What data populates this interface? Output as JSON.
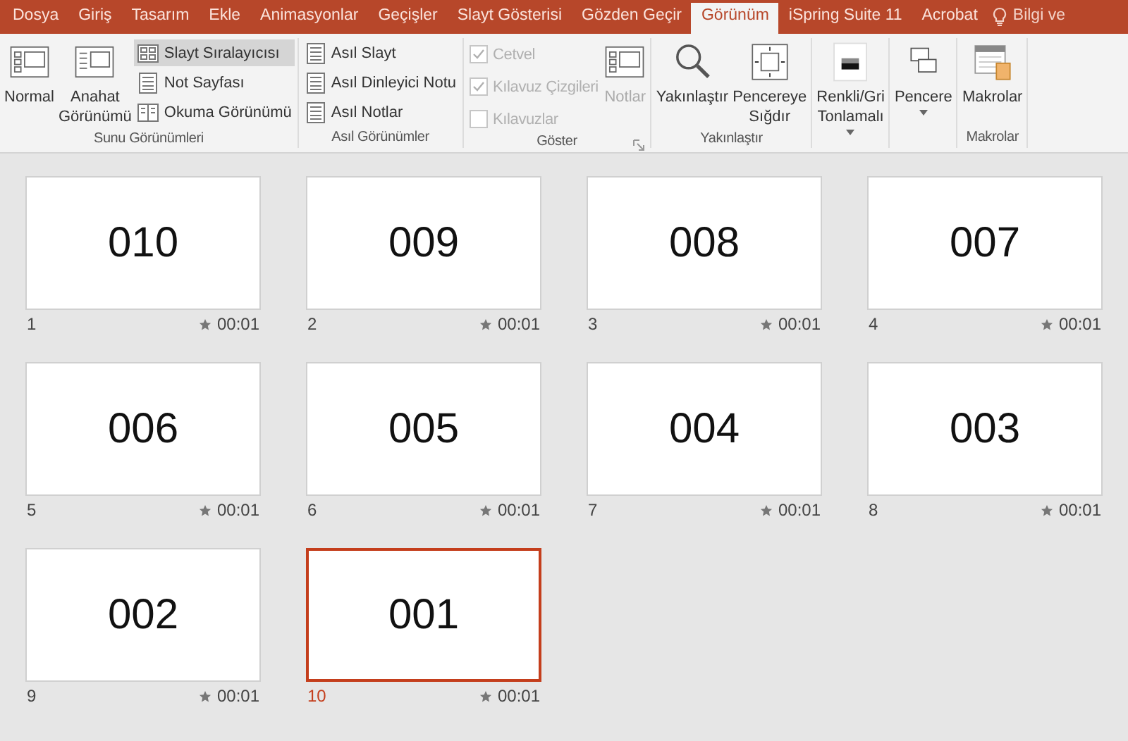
{
  "tabs": [
    {
      "label": "Dosya",
      "selected": false
    },
    {
      "label": "Giriş",
      "selected": false
    },
    {
      "label": "Tasarım",
      "selected": false
    },
    {
      "label": "Ekle",
      "selected": false
    },
    {
      "label": "Animasyonlar",
      "selected": false
    },
    {
      "label": "Geçişler",
      "selected": false
    },
    {
      "label": "Slayt Gösterisi",
      "selected": false
    },
    {
      "label": "Gözden Geçir",
      "selected": false
    },
    {
      "label": "Görünüm",
      "selected": true
    },
    {
      "label": "iSpring Suite 11",
      "selected": false
    },
    {
      "label": "Acrobat",
      "selected": false
    }
  ],
  "tell_me": {
    "label": "Bilgi ve"
  },
  "ribbon": [
    {
      "label": "Sunu Görünümleri",
      "columns": [
        {
          "kind": "large",
          "label": "Normal",
          "disabled": false,
          "dropdown": false
        },
        {
          "kind": "large",
          "label": "Anahat Görünümü",
          "disabled": false,
          "dropdown": false
        },
        {
          "kind": "stack",
          "items": [
            {
              "kind": "small",
              "label": "Slayt Sıralayıcısı",
              "selected": true
            },
            {
              "kind": "small",
              "label": "Not Sayfası",
              "selected": false
            },
            {
              "kind": "small",
              "label": "Okuma Görünümü",
              "selected": false
            }
          ]
        }
      ]
    },
    {
      "label": "Asıl Görünümler",
      "columns": [
        {
          "kind": "stack",
          "items": [
            {
              "kind": "small",
              "label": "Asıl Slayt",
              "selected": false
            },
            {
              "kind": "small",
              "label": "Asıl Dinleyici Notu",
              "selected": false
            },
            {
              "kind": "small",
              "label": "Asıl Notlar",
              "selected": false
            }
          ]
        }
      ]
    },
    {
      "label": "Göster",
      "launcher": true,
      "columns": [
        {
          "kind": "stack",
          "items": [
            {
              "kind": "check",
              "label": "Cetvel",
              "checked": true,
              "disabled": true
            },
            {
              "kind": "check",
              "label": "Kılavuz Çizgileri",
              "checked": true,
              "disabled": true
            },
            {
              "kind": "check",
              "label": "Kılavuzlar",
              "checked": false,
              "disabled": true
            }
          ]
        },
        {
          "kind": "large",
          "label": "Notlar",
          "disabled": true,
          "dropdown": false
        }
      ]
    },
    {
      "label": "Yakınlaştır",
      "columns": [
        {
          "kind": "large",
          "label": "Yakınlaştır",
          "disabled": false,
          "dropdown": false
        },
        {
          "kind": "large",
          "label": "Pencereye Sığdır",
          "disabled": false,
          "dropdown": false
        }
      ]
    },
    {
      "columns": [
        {
          "kind": "large",
          "label": "Renkli/Gri Tonlamalı",
          "disabled": false,
          "dropdown": true
        }
      ]
    },
    {
      "columns": [
        {
          "kind": "large",
          "label": "Pencere",
          "disabled": false,
          "dropdown": true
        }
      ]
    },
    {
      "label": "Makrolar",
      "columns": [
        {
          "kind": "large",
          "label": "Makrolar",
          "disabled": false,
          "dropdown": false
        }
      ]
    }
  ],
  "slides": [
    {
      "number": "1",
      "title": "010",
      "time": "00:01",
      "selected": false
    },
    {
      "number": "2",
      "title": "009",
      "time": "00:01",
      "selected": false
    },
    {
      "number": "3",
      "title": "008",
      "time": "00:01",
      "selected": false
    },
    {
      "number": "4",
      "title": "007",
      "time": "00:01",
      "selected": false
    },
    {
      "number": "5",
      "title": "006",
      "time": "00:01",
      "selected": false
    },
    {
      "number": "6",
      "title": "005",
      "time": "00:01",
      "selected": false
    },
    {
      "number": "7",
      "title": "004",
      "time": "00:01",
      "selected": false
    },
    {
      "number": "8",
      "title": "003",
      "time": "00:01",
      "selected": false
    },
    {
      "number": "9",
      "title": "002",
      "time": "00:01",
      "selected": false
    },
    {
      "number": "10",
      "title": "001",
      "time": "00:01",
      "selected": true
    }
  ]
}
